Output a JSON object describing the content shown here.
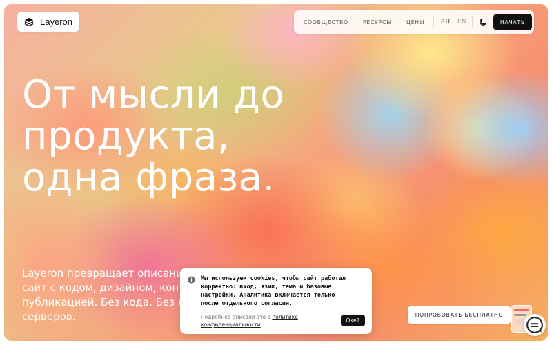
{
  "brand": {
    "name": "Layeron",
    "logo_icon": "layers-icon"
  },
  "nav": {
    "links": [
      "СООБЩЕСТВО",
      "РЕСУРСЫ",
      "ЦЕНЫ"
    ],
    "lang_active": "RU",
    "lang_inactive": "EN",
    "theme_icon": "moon-icon",
    "start_label": "НАЧАТЬ"
  },
  "hero": {
    "headline": [
      "От мысли до",
      "продукта,",
      "одна фраза."
    ],
    "subtext": [
      "Layeron превращает описание",
      "сайт с кодом, дизайном, конте",
      "публикацией. Без кода. Без на",
      "серверов."
    ]
  },
  "cookie": {
    "info_icon": "info-icon",
    "message": [
      "Мы используем cookies, чтобы сайт работал",
      "корректно: вход, язык, тема и базовые",
      "настройки. Аналитика включается только",
      "после отдельного согласия."
    ],
    "more_prefix": "Подробнее описали это в ",
    "more_link_1": "политике",
    "more_link_2": "конфиденциальности",
    "more_suffix": ".",
    "ok_label": "Окей"
  },
  "cta": {
    "try_label": "ПОПРОБОВАТЬ БЕСПЛАТНО"
  },
  "chat": {
    "icon": "chat-icon"
  },
  "colors": {
    "accent_dark": "#111111",
    "surface": "#ffffff"
  }
}
